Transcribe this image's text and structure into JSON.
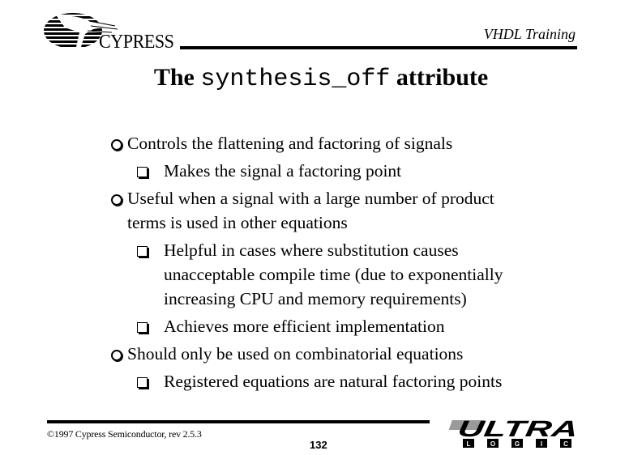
{
  "header": {
    "company_logo_text": "CYPRESS",
    "course_title": "VHDL Training"
  },
  "slide": {
    "title_prefix": "The ",
    "title_code": "synthesis_off",
    "title_suffix": " attribute",
    "bullets": [
      {
        "level": 1,
        "icon": "circle-bullet-icon",
        "lines": [
          "Controls the flattening and factoring of signals"
        ]
      },
      {
        "level": 2,
        "icon": "square-bullet-icon",
        "lines": [
          "Makes the signal a factoring point"
        ]
      },
      {
        "level": 1,
        "icon": "circle-bullet-icon",
        "lines": [
          "Useful when a signal with a large number of product",
          "terms is used in other equations"
        ]
      },
      {
        "level": 2,
        "icon": "square-bullet-icon",
        "lines": [
          "Helpful in cases where substitution causes",
          "unacceptable compile time (due to exponentially",
          "increasing CPU and memory requirements)"
        ]
      },
      {
        "level": 2,
        "icon": "square-bullet-icon",
        "lines": [
          "Achieves more efficient implementation"
        ]
      },
      {
        "level": 1,
        "icon": "circle-bullet-icon",
        "lines": [
          "Should only be used on combinatorial equations"
        ]
      },
      {
        "level": 2,
        "icon": "square-bullet-icon",
        "lines": [
          "Registered equations are natural factoring points"
        ]
      }
    ]
  },
  "footer": {
    "copyright": "©1997 Cypress Semiconductor, rev 2.5.3",
    "page_number": "132",
    "brand_logo_main": "ULTRA",
    "brand_logo_letters": [
      "L",
      "O",
      "G",
      "I",
      "C"
    ]
  }
}
